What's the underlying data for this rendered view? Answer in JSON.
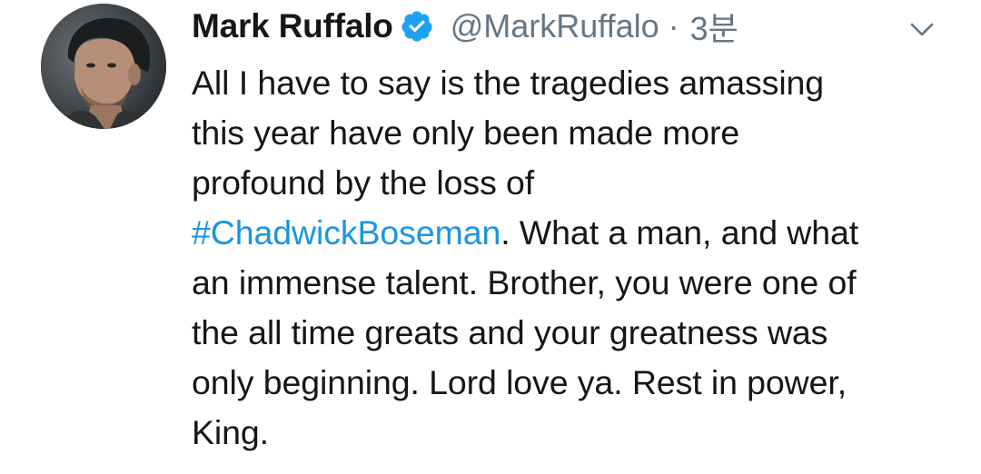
{
  "author": {
    "name": "Mark Ruffalo",
    "handle": "@MarkRuffalo",
    "separator": "·",
    "time": "3분",
    "verified": true
  },
  "tweet": {
    "lines": [
      "All I have to say is the tragedies amassing",
      "this year have only been made more",
      "profound by the loss of"
    ],
    "hashtag": "#ChadwickBoseman",
    "hashtag_line_rest": ". What a man, and what",
    "lines_after": [
      "an immense talent. Brother, you were one of",
      "the all time greats and your greatness was",
      "only beginning. Lord love ya. Rest in power,",
      "King."
    ]
  },
  "colors": {
    "text": "#14171a",
    "secondary": "#657786",
    "link": "#1b95e0",
    "verified": "#1da1f2"
  },
  "icons": {
    "verified": "verified-badge-icon",
    "caret": "chevron-down-icon",
    "avatar": "profile-photo"
  }
}
